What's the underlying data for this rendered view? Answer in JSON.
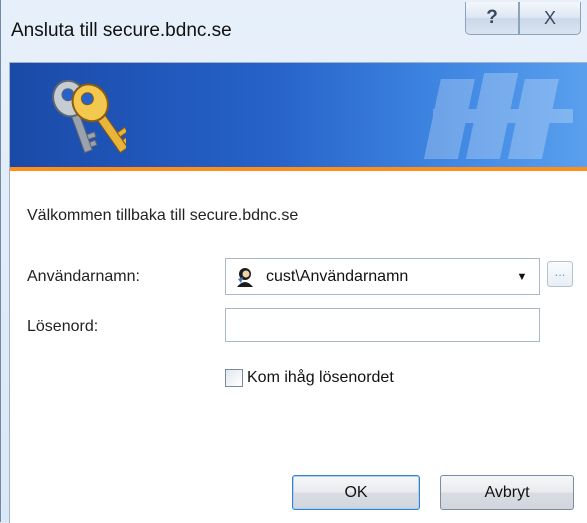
{
  "window": {
    "title": "Ansluta till secure.bdnc.se",
    "help_symbol": "?",
    "close_symbol": "X"
  },
  "banner": {
    "icon": "keys-icon",
    "accent_color": "#ff8f1a",
    "gradient_start": "#1a4aa8",
    "gradient_end": "#5aa0ee"
  },
  "form": {
    "welcome_text": "Välkommen tillbaka till secure.bdnc.se",
    "username_label": "Användarnamn:",
    "username_value": "cust\\Användarnamn",
    "username_icon": "user-icon",
    "browse_label": "...",
    "password_label": "Lösenord:",
    "password_value": "",
    "remember_label": "Kom ihåg lösenordet",
    "remember_checked": false
  },
  "buttons": {
    "ok_label": "OK",
    "cancel_label": "Avbryt"
  }
}
